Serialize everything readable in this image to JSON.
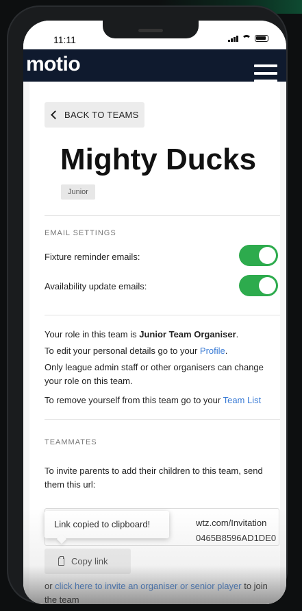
{
  "status_bar": {
    "time": "11:11"
  },
  "navbar": {
    "logo": "motio"
  },
  "back_button": {
    "label": "BACK TO TEAMS"
  },
  "team": {
    "name": "Mighty Ducks",
    "badge": "Junior"
  },
  "email_settings": {
    "heading": "EMAIL SETTINGS",
    "items": [
      {
        "label": "Fixture reminder emails:",
        "enabled": true
      },
      {
        "label": "Availability update emails:",
        "enabled": true
      }
    ]
  },
  "role_info": {
    "line1_prefix": "Your role in this team is ",
    "role": "Junior Team Organiser",
    "line1_suffix": ".",
    "line2_prefix": "To edit your personal details go to your ",
    "line2_link": "Profile",
    "line2_suffix": ".",
    "line3": "Only league admin staff or other organisers can change your role on this team.",
    "line4_prefix": "To remove yourself from this team go to your ",
    "line4_link": "Team List"
  },
  "teammates": {
    "heading": "TEAMMATES",
    "invite_text": "To invite parents to add their children to this team, send them this url:",
    "url_line1": "wtz.com/Invitation",
    "url_line2": "0465B8596AD1DE0",
    "tooltip": "Link copied to clipboard!",
    "copy_button": "Copy link",
    "invite_prefix": "or ",
    "invite_link": "click here to invite an organiser or senior player",
    "invite_suffix": " to join the team"
  },
  "colors": {
    "navbar": "#0f1a2e",
    "toggle_on": "#2dab4d",
    "link": "#3a7bd5"
  }
}
